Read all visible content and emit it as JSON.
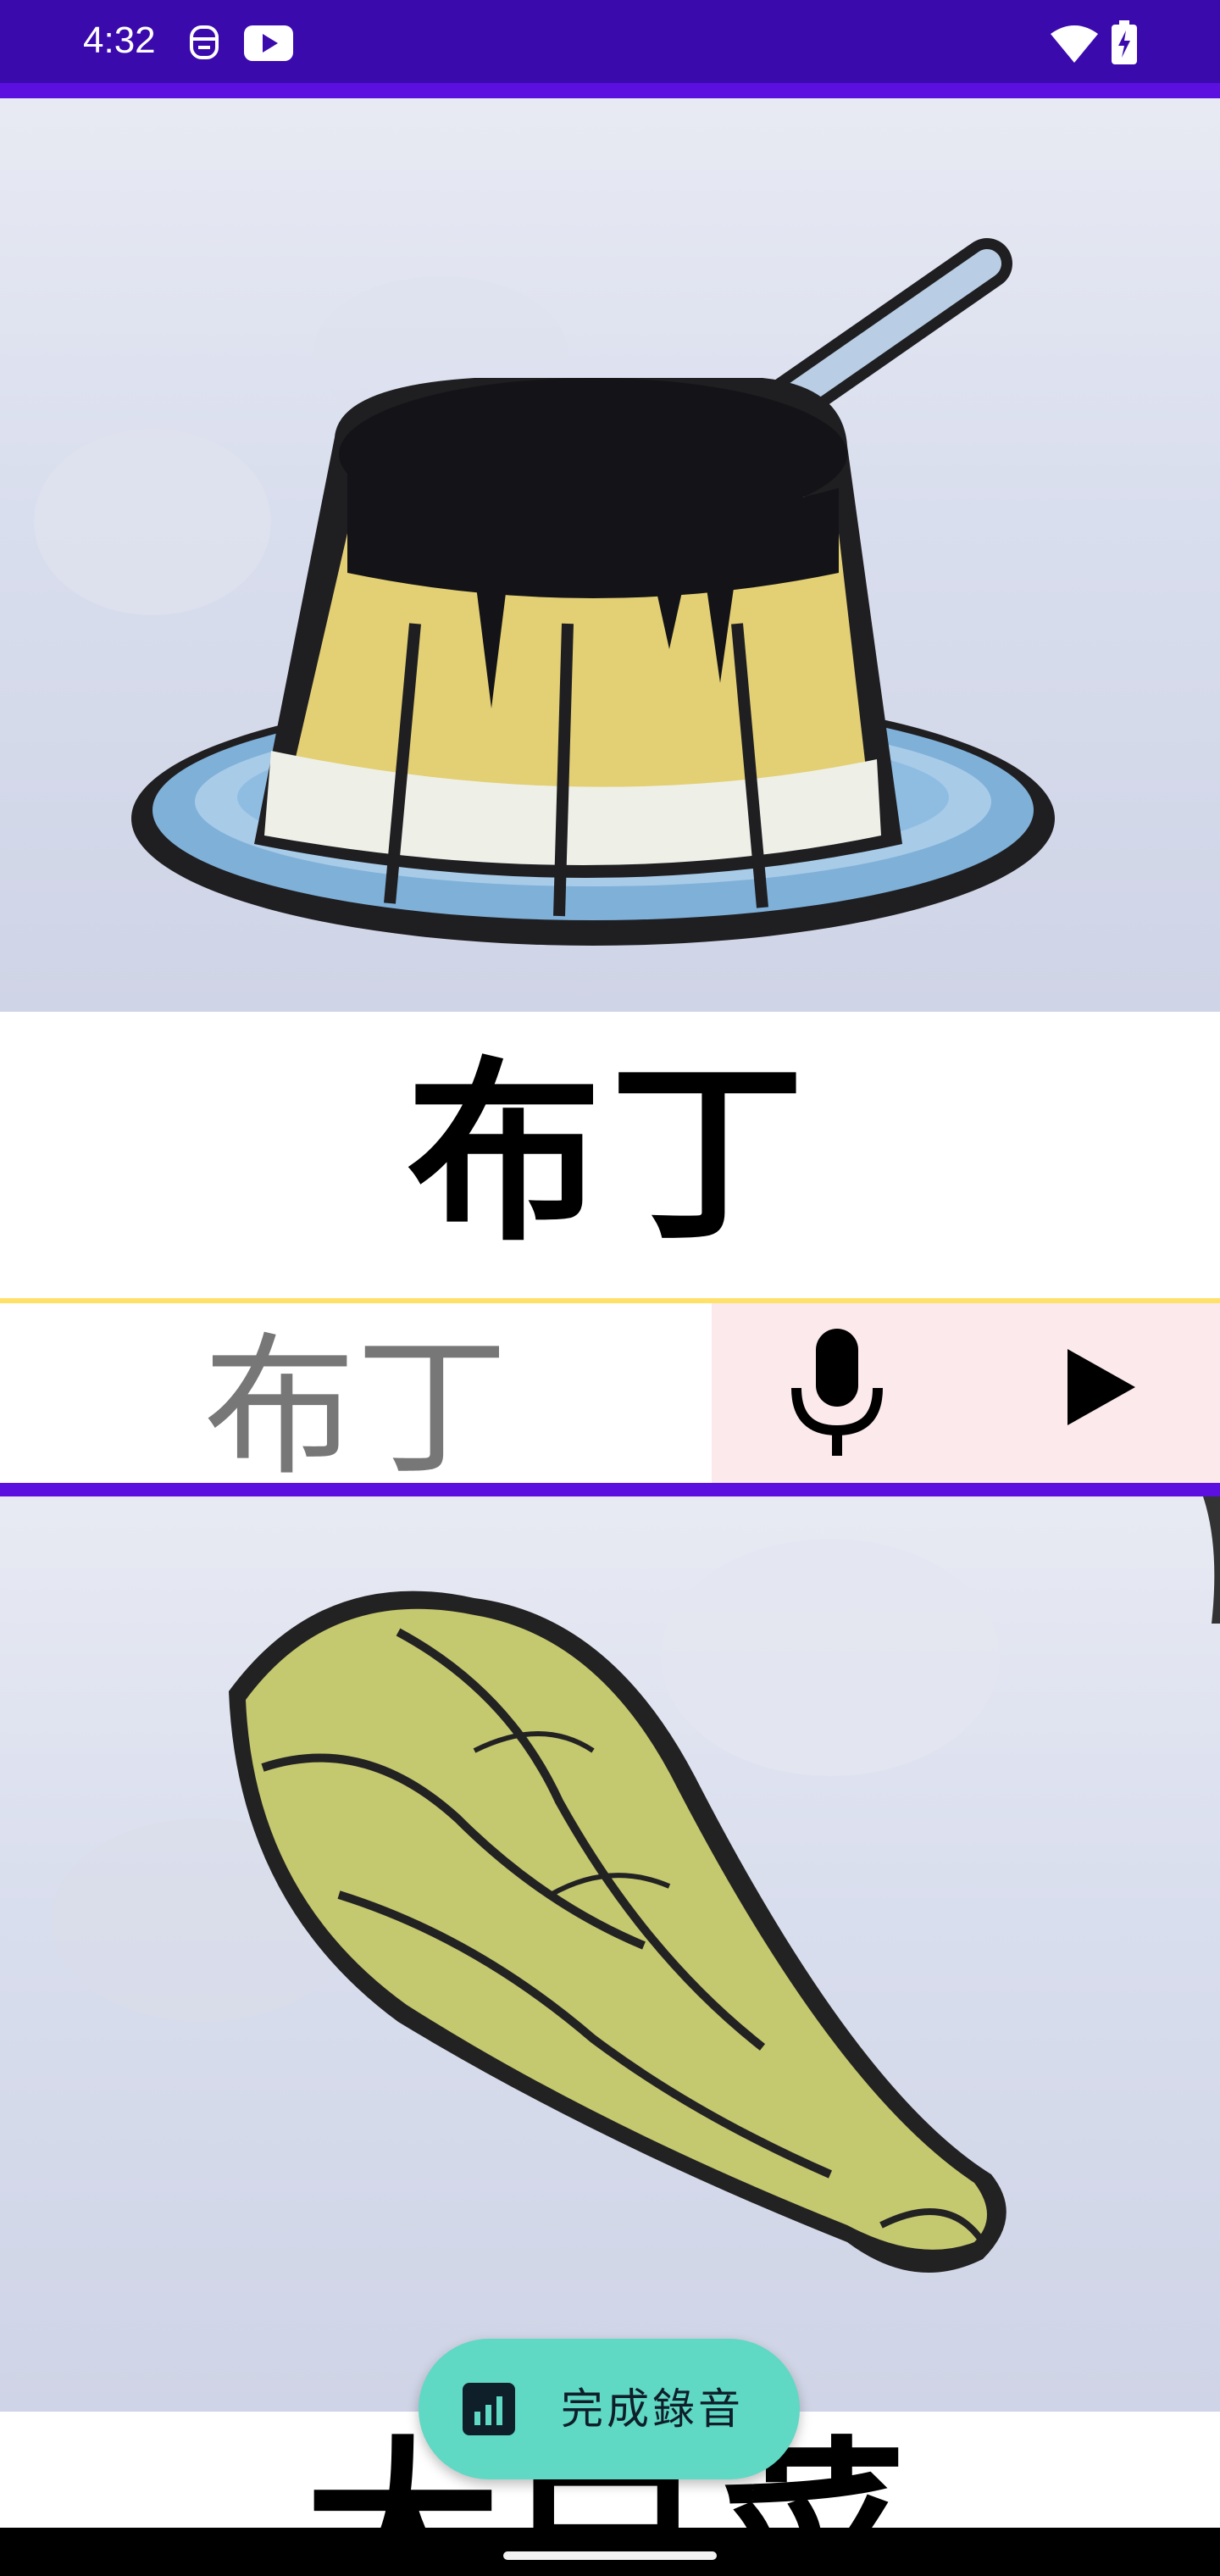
{
  "status_bar": {
    "time": "4:32",
    "icons": [
      "notification-app-icon",
      "youtube-icon",
      "wifi-icon",
      "battery-charging-icon"
    ]
  },
  "cards": [
    {
      "image_icon": "pudding-illustration",
      "title": "布丁",
      "record_word": "布丁",
      "mic_icon": "microphone-icon",
      "play_icon": "play-icon"
    },
    {
      "image_icon": "bok-choy-illustration",
      "title": "大白菜"
    }
  ],
  "fab": {
    "icon": "chart-icon",
    "label": "完成錄音"
  },
  "colors": {
    "status_bar": "#3b0aad",
    "divider": "#5b10e0",
    "accent_line": "#ffe16a",
    "record_controls_bg": "#fbe9ec",
    "fab_bg": "#5fd8c4"
  }
}
